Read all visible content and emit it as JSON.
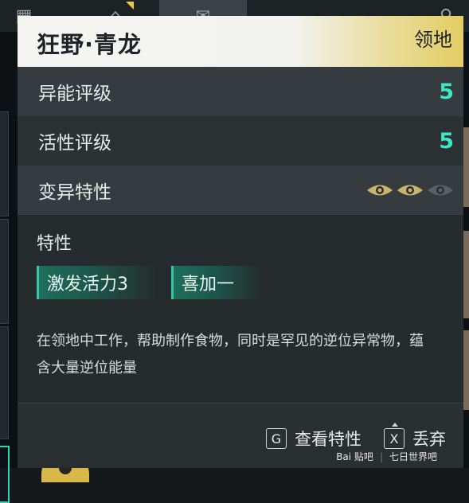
{
  "panel": {
    "title": "狂野·青龙",
    "tag": "领地",
    "stats": [
      {
        "label": "异能评级",
        "value": "5"
      },
      {
        "label": "活性评级",
        "value": "5"
      }
    ],
    "mutation": {
      "label": "变异特性",
      "level": 2,
      "max": 3
    },
    "traits": {
      "title": "特性",
      "items": [
        "激发活力3",
        "喜加一"
      ]
    },
    "description": "在领地中工作，帮助制作食物，同时是罕见的逆位异常物，蕴含大量逆位能量",
    "actions": [
      {
        "key": "G",
        "label": "查看特性"
      },
      {
        "key": "X",
        "label": "丢弃"
      }
    ]
  },
  "watermark": {
    "left": "Bai 贴吧",
    "right": "七日世界吧"
  },
  "colors": {
    "accent": "#3ee6c4",
    "header_gold": "#e3cd64",
    "eye_on": "#c8b46a",
    "eye_off": "#5b6063"
  }
}
